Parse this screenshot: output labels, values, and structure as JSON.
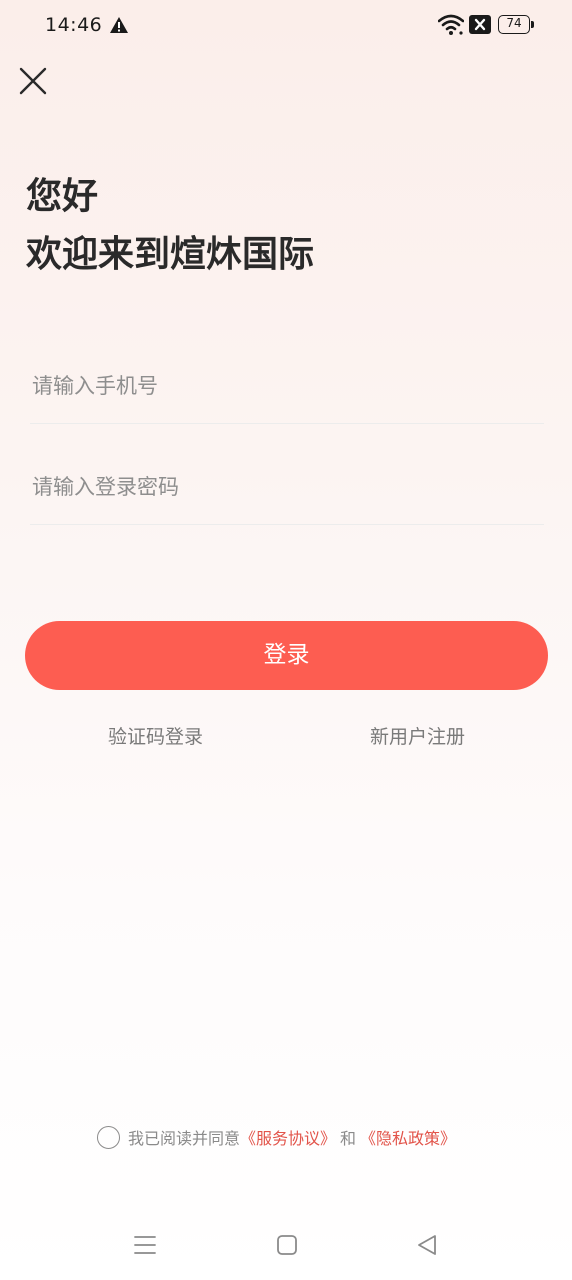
{
  "status_bar": {
    "time": "14:46",
    "battery": "74",
    "icons": [
      "alert-icon",
      "wifi-icon",
      "x-box-icon",
      "battery-icon"
    ]
  },
  "header": {
    "close_icon": "close-icon",
    "greeting": "您好",
    "welcome": "欢迎来到煊炑国际"
  },
  "form": {
    "phone_placeholder": "请输入手机号",
    "phone_value": "",
    "password_placeholder": "请输入登录密码",
    "password_value": "",
    "login_label": "登录"
  },
  "links": {
    "code_login": "验证码登录",
    "register": "新用户注册"
  },
  "agreement": {
    "checked": false,
    "prefix": "我已阅读并同意",
    "service": "《服务协议》",
    "and": "和",
    "privacy": "《隐私政策》"
  },
  "nav_bar": {
    "icons": [
      "menu-icon",
      "home-icon",
      "back-icon"
    ]
  },
  "colors": {
    "accent": "#fd5d51",
    "link": "#e2544a",
    "background_top": "#fbeeea"
  }
}
